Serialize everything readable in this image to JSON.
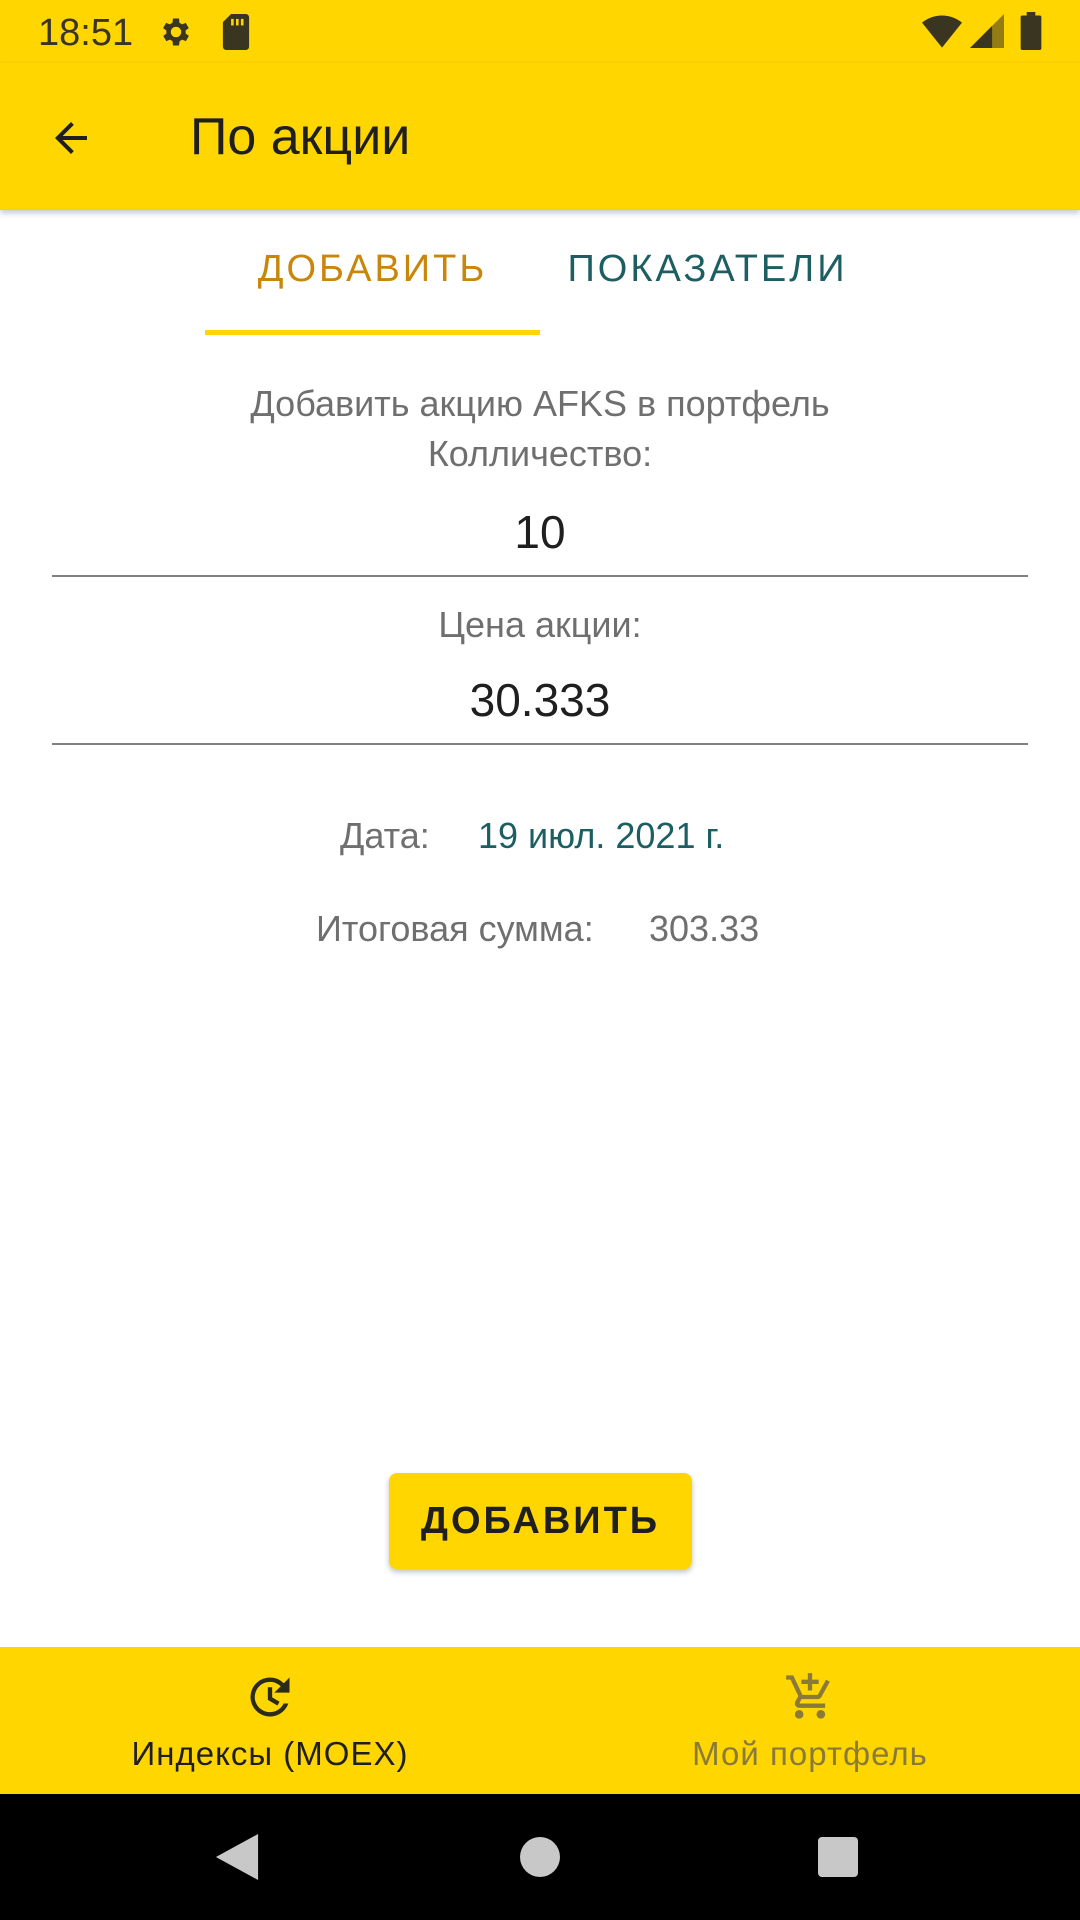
{
  "status_bar": {
    "time": "18:51",
    "icons": [
      "gear-icon",
      "sd-card-icon",
      "wifi-icon",
      "signal-icon",
      "battery-icon"
    ]
  },
  "app_bar": {
    "back_icon": "arrow-left-icon",
    "title": "По акции"
  },
  "tabs": [
    {
      "label": "ДОБАВИТЬ",
      "selected": true
    },
    {
      "label": "ПОКАЗАТЕЛИ",
      "selected": false
    }
  ],
  "form": {
    "description": "Добавить акцию AFKS в портфель",
    "quantity_label": "Колличество:",
    "quantity_value": "10",
    "price_label": "Цена акции:",
    "price_value": "30.333",
    "date_label": "Дата:",
    "date_value": "19 июл. 2021 г.",
    "sum_label": "Итоговая сумма:",
    "sum_value": "303.33",
    "add_button": "ДОБАВИТЬ"
  },
  "bottom_nav": [
    {
      "label": "Индексы (MOEX)",
      "icon": "history-clock-icon",
      "active": true
    },
    {
      "label": "Мой портфель",
      "icon": "add-to-cart-icon",
      "active": false
    }
  ],
  "colors": {
    "accent": "#FFD600",
    "tab_selected": "#C8860A",
    "tab_unselected": "#1D5E63",
    "date_link": "#1D5E63"
  }
}
